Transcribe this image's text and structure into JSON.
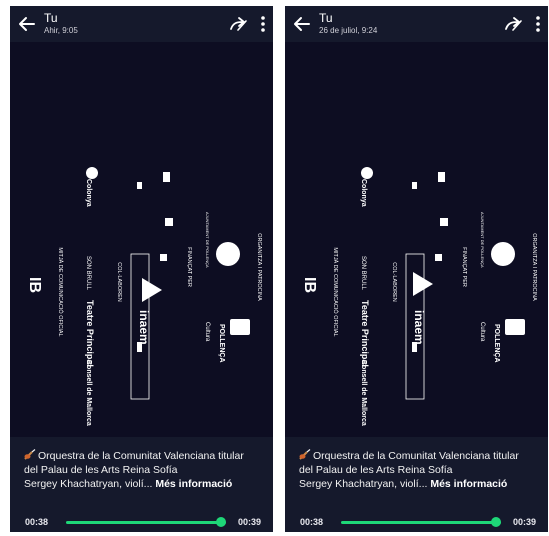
{
  "colors": {
    "accent": "#1ed778",
    "topbar": "#15192c",
    "video_bg": "#0d0d22"
  },
  "icons": {
    "back": "arrow-left-icon",
    "forward": "share-forward-icon",
    "menu": "more-vertical-icon",
    "caption_emoji": "violin-icon",
    "play": "play-icon"
  },
  "left": {
    "title": "Tu",
    "subtitle": "Ahir, 9:05",
    "caption_line1": "Orquestra de la Comunitat Valenciana titular",
    "caption_line2": "del Palau de les Arts Reina Sofía",
    "caption_line3": "Sergey Khachatryan, violí...",
    "more_label": "Més informació",
    "time_current": "00:38",
    "time_total": "00:39",
    "progress": 0.97
  },
  "right": {
    "title": "Tu",
    "subtitle": "26 de juliol, 9:24",
    "caption_line1": "Orquestra de la Comunitat Valenciana titular",
    "caption_line2": "del Palau de les Arts Reina Sofía",
    "caption_line3": "Sergey Khachatryan, violí...",
    "more_label": "Més informació",
    "time_current": "00:38",
    "time_total": "00:39",
    "progress": 0.97
  },
  "credits": {
    "col_organitza": "ORGANITZA I PATROCINA",
    "col_financat": "FINANÇAT PER",
    "col_collaboren": "COL·LABOREN",
    "col_mitja": "MITJÀ DE COMUNICACIÓ OFICIAL",
    "logo_polensa": "POLLENÇA",
    "logo_cultura": "Cultura",
    "logo_ajuntament": "AJUNTAMENT DE POLLENÇA",
    "logo_inaem": "inaem",
    "logo_teatre": "Teatre Principal",
    "logo_consell": "Consell de Mallorca",
    "logo_sonbrull": "SON BRULL",
    "logo_colonya": "Colonya",
    "logo_ib": "IB"
  }
}
